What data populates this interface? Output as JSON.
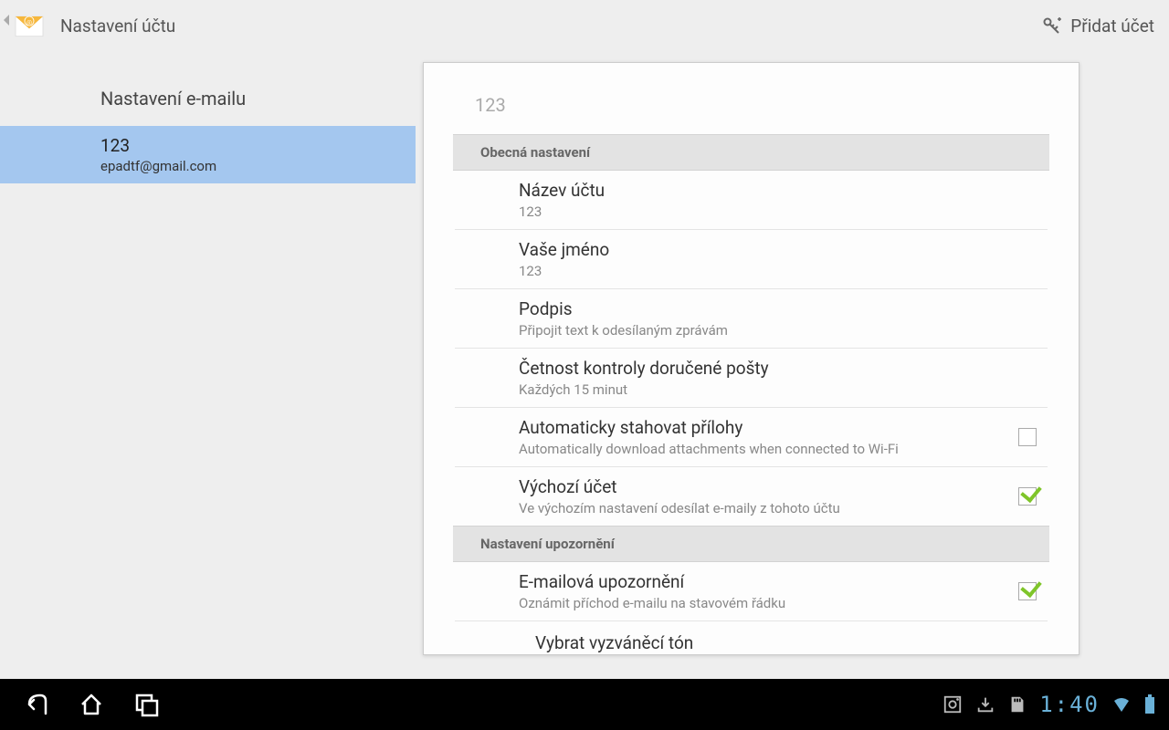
{
  "actionbar": {
    "title": "Nastavení účtu",
    "add_account_label": "Přidat účet"
  },
  "sidebar": {
    "section_title": "Nastavení e-mailu",
    "account": {
      "name": "123",
      "email": "epadtf@gmail.com"
    }
  },
  "panel": {
    "title": "123",
    "group_general": "Obecná nastavení",
    "group_notify": "Nastavení upozornění",
    "rows": {
      "account_name": {
        "title": "Název účtu",
        "sub": "123"
      },
      "your_name": {
        "title": "Vaše jméno",
        "sub": "123"
      },
      "signature": {
        "title": "Podpis",
        "sub": "Připojit text k odesílaným zprávám"
      },
      "check_freq": {
        "title": "Četnost kontroly doručené pošty",
        "sub": "Každých 15 minut"
      },
      "auto_download": {
        "title": "Automaticky stahovat přílohy",
        "sub": "Automatically download attachments when connected to Wi-Fi",
        "checked": false
      },
      "default_account": {
        "title": "Výchozí účet",
        "sub": "Ve výchozím nastavení odesílat e-maily z tohoto účtu",
        "checked": true
      },
      "email_notify": {
        "title": "E-mailová upozornění",
        "sub": "Oznámit příchod e-mailu na stavovém řádku",
        "checked": true
      },
      "ringtone": {
        "title": "Vybrat vyzváněcí tón"
      }
    }
  },
  "sysbar": {
    "clock": "1:40"
  }
}
